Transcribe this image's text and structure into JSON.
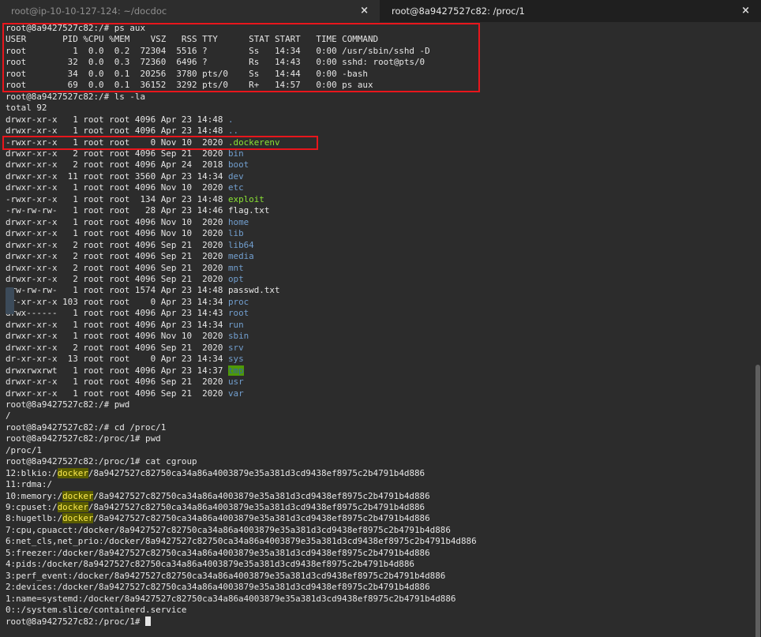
{
  "tabs": [
    {
      "title": "root@ip-10-10-127-124: ~/docdoc",
      "active": false
    },
    {
      "title": "root@8a9427527c82: /proc/1",
      "active": true
    }
  ],
  "close_glyph": "×",
  "colors": {
    "background": "#2c2c2c",
    "text": "#e6e6e6",
    "directory": "#729fcf",
    "executable": "#8ae234",
    "highlight": "#5a5d00",
    "annotation_box": "#e8161c"
  },
  "lines": [
    [
      {
        "t": "root@8a9427527c82:/# ps aux"
      }
    ],
    [
      {
        "t": "USER       PID %CPU %MEM    VSZ   RSS TTY      STAT START   TIME COMMAND"
      }
    ],
    [
      {
        "t": "root         1  0.0  0.2  72304  5516 ?        Ss   14:34   0:00 /usr/sbin/sshd -D"
      }
    ],
    [
      {
        "t": "root        32  0.0  0.3  72360  6496 ?        Rs   14:43   0:00 sshd: root@pts/0"
      }
    ],
    [
      {
        "t": "root        34  0.0  0.1  20256  3780 pts/0    Ss   14:44   0:00 -bash"
      }
    ],
    [
      {
        "t": "root        69  0.0  0.1  36152  3292 pts/0    R+   14:57   0:00 ps aux"
      }
    ],
    [
      {
        "t": "root@8a9427527c82:/# ls -la"
      }
    ],
    [
      {
        "t": "total 92"
      }
    ],
    [
      {
        "t": "drwxr-xr-x   1 root root 4096 Apr 23 14:48 "
      },
      {
        "t": ".",
        "c": "dir"
      }
    ],
    [
      {
        "t": "drwxr-xr-x   1 root root 4096 Apr 23 14:48 "
      },
      {
        "t": "..",
        "c": "dir"
      }
    ],
    [
      {
        "t": "-rwxr-xr-x   1 root root    0 Nov 10  2020 "
      },
      {
        "t": ".dockerenv",
        "c": "exe"
      }
    ],
    [
      {
        "t": "drwxr-xr-x   2 root root 4096 Sep 21  2020 "
      },
      {
        "t": "bin",
        "c": "dir"
      }
    ],
    [
      {
        "t": "drwxr-xr-x   2 root root 4096 Apr 24  2018 "
      },
      {
        "t": "boot",
        "c": "dir"
      }
    ],
    [
      {
        "t": "drwxr-xr-x  11 root root 3560 Apr 23 14:34 "
      },
      {
        "t": "dev",
        "c": "dir"
      }
    ],
    [
      {
        "t": "drwxr-xr-x   1 root root 4096 Nov 10  2020 "
      },
      {
        "t": "etc",
        "c": "dir"
      }
    ],
    [
      {
        "t": "-rwxr-xr-x   1 root root  134 Apr 23 14:48 "
      },
      {
        "t": "exploit",
        "c": "exe"
      }
    ],
    [
      {
        "t": "-rw-rw-rw-   1 root root   28 Apr 23 14:46 flag.txt"
      }
    ],
    [
      {
        "t": "drwxr-xr-x   1 root root 4096 Nov 10  2020 "
      },
      {
        "t": "home",
        "c": "dir"
      }
    ],
    [
      {
        "t": "drwxr-xr-x   1 root root 4096 Nov 10  2020 "
      },
      {
        "t": "lib",
        "c": "dir"
      }
    ],
    [
      {
        "t": "drwxr-xr-x   2 root root 4096 Sep 21  2020 "
      },
      {
        "t": "lib64",
        "c": "dir"
      }
    ],
    [
      {
        "t": "drwxr-xr-x   2 root root 4096 Sep 21  2020 "
      },
      {
        "t": "media",
        "c": "dir"
      }
    ],
    [
      {
        "t": "drwxr-xr-x   2 root root 4096 Sep 21  2020 "
      },
      {
        "t": "mnt",
        "c": "dir"
      }
    ],
    [
      {
        "t": "drwxr-xr-x   2 root root 4096 Sep 21  2020 "
      },
      {
        "t": "opt",
        "c": "dir"
      }
    ],
    [
      {
        "t": "-rw-rw-rw-   1 root root 1574 Apr 23 14:48 passwd.txt"
      }
    ],
    [
      {
        "t": "dr-xr-xr-x 103 root root    0 Apr 23 14:34 "
      },
      {
        "t": "proc",
        "c": "dir"
      }
    ],
    [
      {
        "t": "drwx------   1 root root 4096 Apr 23 14:43 "
      },
      {
        "t": "root",
        "c": "dir"
      }
    ],
    [
      {
        "t": "drwxr-xr-x   1 root root 4096 Apr 23 14:34 "
      },
      {
        "t": "run",
        "c": "dir"
      }
    ],
    [
      {
        "t": "drwxr-xr-x   1 root root 4096 Nov 10  2020 "
      },
      {
        "t": "sbin",
        "c": "dir"
      }
    ],
    [
      {
        "t": "drwxr-xr-x   2 root root 4096 Sep 21  2020 "
      },
      {
        "t": "srv",
        "c": "dir"
      }
    ],
    [
      {
        "t": "dr-xr-xr-x  13 root root    0 Apr 23 14:34 "
      },
      {
        "t": "sys",
        "c": "dir"
      }
    ],
    [
      {
        "t": "drwxrwxrwt   1 root root 4096 Apr 23 14:37 "
      },
      {
        "t": "tmp",
        "c": "tmp"
      }
    ],
    [
      {
        "t": "drwxr-xr-x   1 root root 4096 Sep 21  2020 "
      },
      {
        "t": "usr",
        "c": "dir"
      }
    ],
    [
      {
        "t": "drwxr-xr-x   1 root root 4096 Sep 21  2020 "
      },
      {
        "t": "var",
        "c": "dir"
      }
    ],
    [
      {
        "t": "root@8a9427527c82:/# pwd"
      }
    ],
    [
      {
        "t": "/"
      }
    ],
    [
      {
        "t": "root@8a9427527c82:/# cd /proc/1"
      }
    ],
    [
      {
        "t": "root@8a9427527c82:/proc/1# pwd"
      }
    ],
    [
      {
        "t": "/proc/1"
      }
    ],
    [
      {
        "t": "root@8a9427527c82:/proc/1# cat cgroup"
      }
    ],
    [
      {
        "t": "12:blkio:/"
      },
      {
        "t": "docker",
        "c": "hl"
      },
      {
        "t": "/8a9427527c82750ca34a86a4003879e35a381d3cd9438ef8975c2b4791b4d886"
      }
    ],
    [
      {
        "t": "11:rdma:/"
      }
    ],
    [
      {
        "t": "10:memory:/"
      },
      {
        "t": "docker",
        "c": "hl"
      },
      {
        "t": "/8a9427527c82750ca34a86a4003879e35a381d3cd9438ef8975c2b4791b4d886"
      }
    ],
    [
      {
        "t": "9:cpuset:/"
      },
      {
        "t": "docker",
        "c": "hl"
      },
      {
        "t": "/8a9427527c82750ca34a86a4003879e35a381d3cd9438ef8975c2b4791b4d886"
      }
    ],
    [
      {
        "t": "8:hugetlb:/"
      },
      {
        "t": "docker",
        "c": "hl"
      },
      {
        "t": "/8a9427527c82750ca34a86a4003879e35a381d3cd9438ef8975c2b4791b4d886"
      }
    ],
    [
      {
        "t": "7:cpu,cpuacct:/docker/8a9427527c82750ca34a86a4003879e35a381d3cd9438ef8975c2b4791b4d886"
      }
    ],
    [
      {
        "t": "6:net_cls,net_prio:/docker/8a9427527c82750ca34a86a4003879e35a381d3cd9438ef8975c2b4791b4d886"
      }
    ],
    [
      {
        "t": "5:freezer:/docker/8a9427527c82750ca34a86a4003879e35a381d3cd9438ef8975c2b4791b4d886"
      }
    ],
    [
      {
        "t": "4:pids:/docker/8a9427527c82750ca34a86a4003879e35a381d3cd9438ef8975c2b4791b4d886"
      }
    ],
    [
      {
        "t": "3:perf_event:/docker/8a9427527c82750ca34a86a4003879e35a381d3cd9438ef8975c2b4791b4d886"
      }
    ],
    [
      {
        "t": "2:devices:/docker/8a9427527c82750ca34a86a4003879e35a381d3cd9438ef8975c2b4791b4d886"
      }
    ],
    [
      {
        "t": "1:name=systemd:/docker/8a9427527c82750ca34a86a4003879e35a381d3cd9438ef8975c2b4791b4d886"
      }
    ],
    [
      {
        "t": "0::/system.slice/containerd.service"
      }
    ],
    [
      {
        "t": "root@8a9427527c82:/proc/1# "
      },
      {
        "t": "",
        "c": "cursor"
      }
    ]
  ]
}
